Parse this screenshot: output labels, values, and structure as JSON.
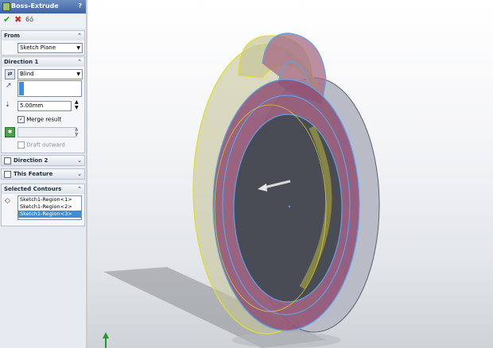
{
  "panel": {
    "title": "Boss-Extrude",
    "help": "?",
    "actions": {
      "ok": "✔",
      "cancel": "✖",
      "detail": "6ó"
    },
    "from": {
      "header": "From",
      "value": "Sketch Plane"
    },
    "direction1": {
      "header": "Direction 1",
      "end_condition": "Blind",
      "depth": "5.00mm",
      "merge_result": "Merge result",
      "draft_outward": "Draft outward"
    },
    "direction2": {
      "header": "Direction 2"
    },
    "this_feature": {
      "header": "This Feature"
    },
    "selected_contours": {
      "header": "Selected Contours",
      "items": [
        "Sketch1-Region<1>",
        "Sketch1-Region<2>",
        "Sketch1-Region<3>"
      ]
    }
  },
  "colors": {
    "accent": "#3b8fd9",
    "title": "#3d62a3",
    "check": "#2aa52a",
    "cancel": "#d12b2b"
  }
}
